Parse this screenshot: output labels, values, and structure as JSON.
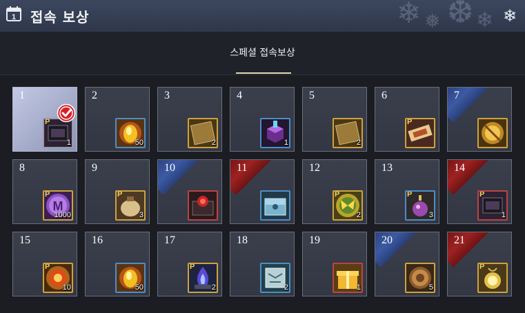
{
  "window": {
    "title": "접속 보상",
    "calendar_day": "1",
    "close_icon": "snowflake-close-icon"
  },
  "tabs": [
    {
      "label": "스페셜 접속보상",
      "active": true
    }
  ],
  "colors": {
    "gold_border": "#cea33e",
    "blue_border": "#4c8ec7",
    "red_border": "#b84545",
    "blue_ribbon": "#3c5aa3",
    "red_ribbon": "#9e2222"
  },
  "rewards": [
    {
      "day": "1",
      "qty": "1",
      "premium": "P",
      "icon": "black-scroll-icon",
      "claimed": true
    },
    {
      "day": "2",
      "qty": "50",
      "premium": "",
      "icon": "fire-crystal-icon"
    },
    {
      "day": "3",
      "qty": "2",
      "premium": "",
      "icon": "gold-book-icon"
    },
    {
      "day": "4",
      "qty": "1",
      "premium": "",
      "icon": "purple-cube-icon"
    },
    {
      "day": "5",
      "qty": "2",
      "premium": "",
      "icon": "gold-book-icon"
    },
    {
      "day": "6",
      "qty": "",
      "premium": "P",
      "icon": "ticket-icon"
    },
    {
      "day": "7",
      "qty": "",
      "premium": "",
      "icon": "golden-sword-orb-icon",
      "ribbon": "blue"
    },
    {
      "day": "8",
      "qty": "1000",
      "premium": "P",
      "icon": "purple-m-coin-icon"
    },
    {
      "day": "9",
      "qty": "3",
      "premium": "P",
      "icon": "pouch-icon"
    },
    {
      "day": "10",
      "qty": "",
      "premium": "",
      "icon": "red-chest-icon",
      "ribbon": "blue"
    },
    {
      "day": "11",
      "qty": "",
      "premium": "",
      "icon": "silver-chest-icon",
      "ribbon": "red"
    },
    {
      "day": "12",
      "qty": "2",
      "premium": "P",
      "icon": "butterfly-orb-icon"
    },
    {
      "day": "13",
      "qty": "3",
      "premium": "P",
      "icon": "potion-icon"
    },
    {
      "day": "14",
      "qty": "1",
      "premium": "P",
      "icon": "black-scroll-icon",
      "ribbon": "red"
    },
    {
      "day": "15",
      "qty": "10",
      "premium": "P",
      "icon": "fire-orb-icon"
    },
    {
      "day": "16",
      "qty": "50",
      "premium": "",
      "icon": "fire-crystal-icon"
    },
    {
      "day": "17",
      "qty": "2",
      "premium": "P",
      "icon": "blue-flame-icon"
    },
    {
      "day": "18",
      "qty": "2",
      "premium": "",
      "icon": "map-scroll-icon"
    },
    {
      "day": "19",
      "qty": "1",
      "premium": "",
      "icon": "gift-box-icon"
    },
    {
      "day": "20",
      "qty": "5",
      "premium": "",
      "icon": "bronze-coin-icon",
      "ribbon": "blue"
    },
    {
      "day": "21",
      "qty": "",
      "premium": "P",
      "icon": "gold-amulet-icon",
      "ribbon": "red"
    }
  ]
}
